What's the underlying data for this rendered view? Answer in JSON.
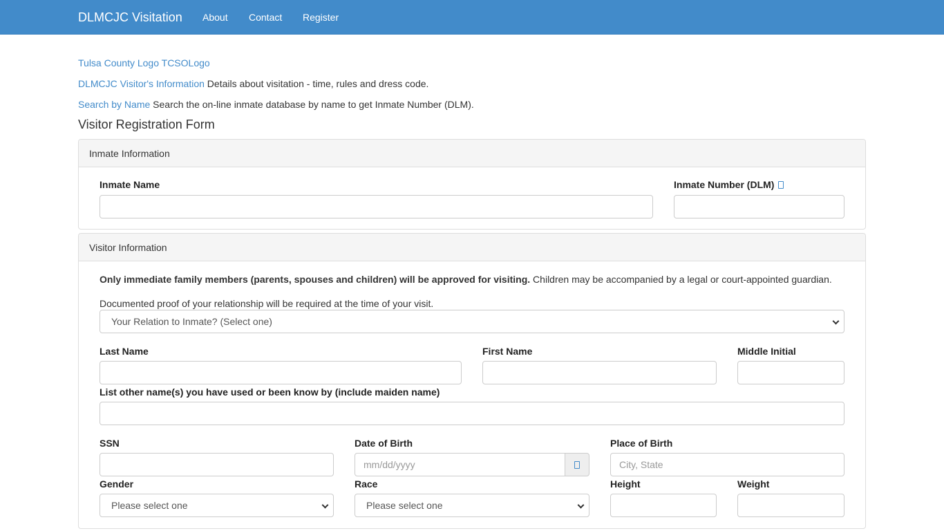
{
  "navbar": {
    "brand": "DLMCJC Visitation",
    "links": [
      "About",
      "Contact",
      "Register"
    ],
    "color": "#428bca"
  },
  "header": {
    "logos": [
      "Tulsa County Logo",
      "TCSOLogo"
    ],
    "info_link": "DLMCJC Visitor's Information",
    "info_text": " Details about visitation - time, rules and dress code.",
    "search_link": "Search by Name",
    "search_text": " Search the on-line inmate database by name to get Inmate Number (DLM).",
    "form_title": "Visitor Registration Form"
  },
  "inmate_panel": {
    "title": "Inmate Information",
    "name_label": "Inmate Name",
    "name_value": "",
    "number_label": "Inmate Number (DLM)",
    "number_value": ""
  },
  "visitor_panel": {
    "title": "Visitor Information",
    "notice_bold": "Only immediate family members (parents, spouses and children) will be approved for visiting.",
    "notice_rest": " Children may be accompanied by a legal or court-appointed guardian.",
    "proof_text": "Documented proof of your relationship will be required at the time of your visit.",
    "relation_select": "Your Relation to Inmate? (Select one)",
    "last_name_label": "Last Name",
    "first_name_label": "First Name",
    "middle_initial_label": "Middle Initial",
    "other_names_label": "List other name(s) you have used or been know by (include maiden name)",
    "ssn_label": "SSN",
    "dob_label": "Date of Birth",
    "dob_placeholder": "mm/dd/yyyy",
    "pob_label": "Place of Birth",
    "pob_placeholder": "City, State",
    "gender_label": "Gender",
    "gender_select": "Please select one",
    "race_label": "Race",
    "race_select": "Please select one",
    "height_label": "Height",
    "weight_label": "Weight"
  }
}
